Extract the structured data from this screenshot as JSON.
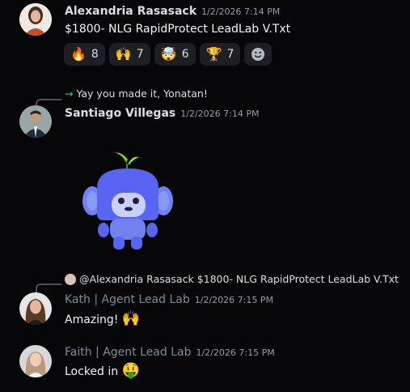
{
  "messages": [
    {
      "author": "Alexandria Rasasack",
      "timestamp": "1/2/2026 7:14 PM",
      "text": "$1800- NLG RapidProtect LeadLab V.Txt",
      "reactions": [
        {
          "emoji": "🔥",
          "count": "8"
        },
        {
          "emoji": "🙌",
          "count": "7"
        },
        {
          "emoji": "🤯",
          "count": "6"
        },
        {
          "emoji": "🏆",
          "count": "7"
        }
      ],
      "add_reaction_icon": "smiley-icon"
    },
    {
      "reply_text": "Yay you made it, Yonatan!",
      "author": "Santiago Villegas",
      "timestamp": "1/2/2026 7:14 PM",
      "sticker": "discord-wumpus-sticker"
    },
    {
      "reply_author": "@Alexandria Rasasack",
      "reply_text": "$1800- NLG RapidProtect LeadLab V.Txt",
      "author": "Kath | Agent Lead Lab",
      "timestamp": "1/2/2026 7:15 PM",
      "text": "Amazing!",
      "emoji": "🙌"
    },
    {
      "author": "Faith | Agent Lead Lab",
      "timestamp": "1/2/2026 7:15 PM",
      "text": "Locked in",
      "emoji": "🤑"
    }
  ],
  "colors": {
    "background": "#070709",
    "role_color": "#7b8c9a",
    "reply_arrow": "#3ba55d"
  }
}
